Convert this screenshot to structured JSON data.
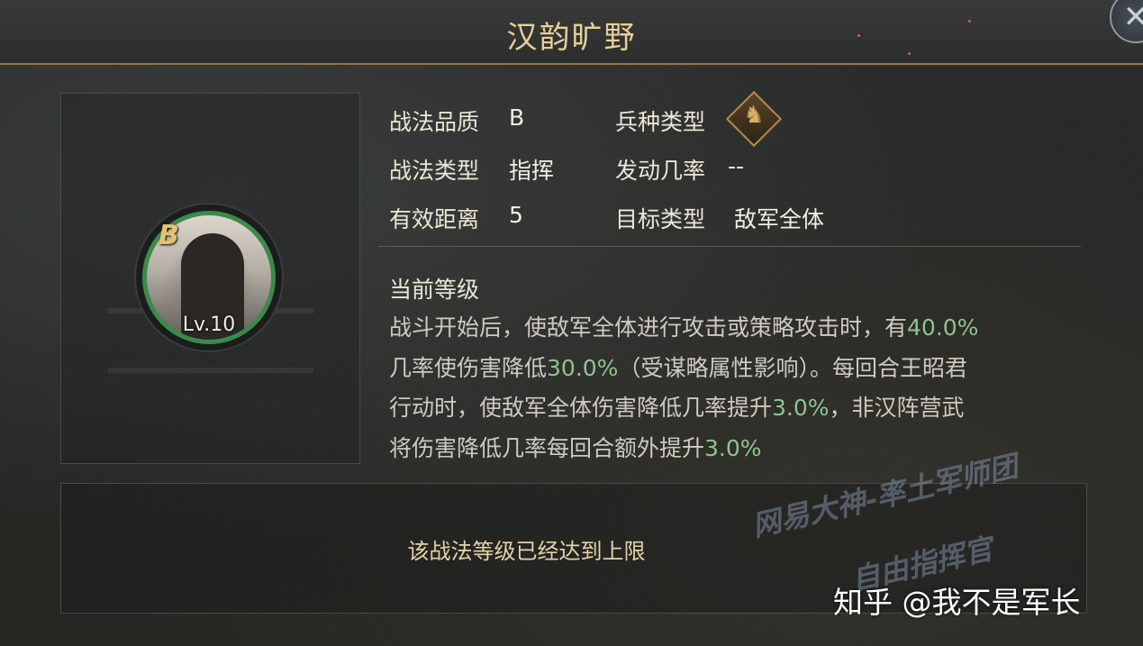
{
  "header": {
    "title": "汉韵旷野"
  },
  "skill": {
    "grade_badge": "B",
    "level_label": "Lv.10"
  },
  "info": {
    "quality_label": "战法品质",
    "quality_value": "B",
    "unit_type_label": "兵种类型",
    "unit_type_icon": "horse-icon",
    "tactic_type_label": "战法类型",
    "tactic_type_value": "指挥",
    "trigger_rate_label": "发动几率",
    "trigger_rate_value": "--",
    "range_label": "有效距离",
    "range_value": "5",
    "target_label": "目标类型",
    "target_value": "敌军全体"
  },
  "description": {
    "heading": "当前等级",
    "parts": [
      "战斗开始后，使敌军全体进行攻击或策略攻击时，有",
      "40.0%",
      "\n几率使伤害降低",
      "30.0%",
      "（受谋略属性影响）。每回合王昭君\n行动时，使敌军全体伤害降低几率提升",
      "3.0%",
      "，非汉阵营武\n将伤害降低几率每回合额外提升",
      "3.0%"
    ]
  },
  "footer": {
    "max_level_message": "该战法等级已经达到上限"
  },
  "watermark": {
    "line1": "网易大神-率土军师团",
    "line2": "自由指挥官",
    "source": "知乎 @我不是军长"
  },
  "colors": {
    "title": "#e8cf99",
    "highlight": "#8ec48e",
    "ring": "#3b8a49",
    "border_gold": "#8a7650"
  }
}
